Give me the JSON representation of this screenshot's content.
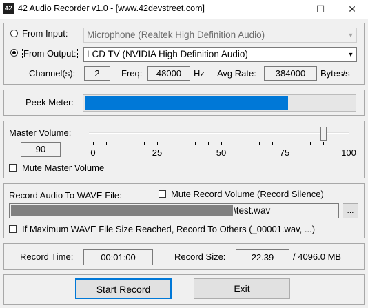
{
  "window": {
    "app_icon_text": "42",
    "title": "42 Audio Recorder v1.0 - [www.42devstreet.com]"
  },
  "source": {
    "from_input_label": "From Input:",
    "from_input_value": "Microphone (Realtek High Definition Audio)",
    "from_output_label": "From Output:",
    "from_output_value": "LCD TV (NVIDIA High Definition Audio)",
    "selected": "output"
  },
  "format": {
    "channels_label": "Channel(s):",
    "channels_value": "2",
    "freq_label": "Freq:",
    "freq_value": "48000",
    "freq_unit": "Hz",
    "avg_rate_label": "Avg Rate:",
    "avg_rate_value": "384000",
    "avg_rate_unit": "Bytes/s"
  },
  "meter": {
    "label": "Peek Meter:",
    "level_fraction": 0.75,
    "color": "#0078d7"
  },
  "volume": {
    "label": "Master Volume:",
    "value": "90",
    "level": 90,
    "ticks": [
      "0",
      "25",
      "50",
      "75",
      "100"
    ],
    "mute_label": "Mute Master Volume"
  },
  "record_file": {
    "label": "Record Audio To WAVE File:",
    "mute_record_label": "Mute Record Volume (Record Silence)",
    "file_suffix": "\\test.wav",
    "browse_label": "...",
    "max_size_label": "If Maximum WAVE File Size Reached, Record To Others (_00001.wav, ...)"
  },
  "status": {
    "time_label": "Record Time:",
    "time_value": "00:01:00",
    "size_label": "Record Size:",
    "size_value": "22.39",
    "size_total": "/ 4096.0 MB"
  },
  "actions": {
    "start_label": "Start Record",
    "exit_label": "Exit"
  }
}
